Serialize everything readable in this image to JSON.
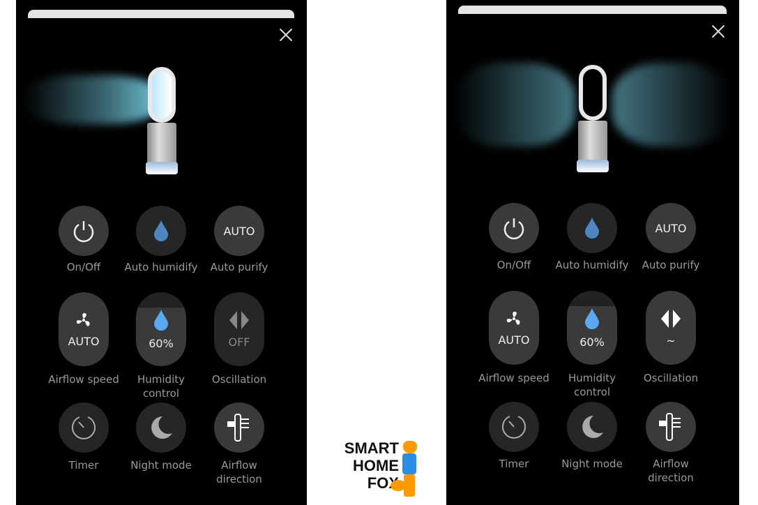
{
  "panels": [
    {
      "buttons": [
        {
          "type": "circle",
          "icon": "power-icon",
          "label": "On/Off"
        },
        {
          "type": "circle",
          "icon": "water-drop-icon",
          "label": "Auto humidify",
          "bg": "#262626",
          "iconColor": "#4f86c0"
        },
        {
          "type": "circle",
          "text": "AUTO",
          "label": "Auto purify"
        },
        {
          "type": "pill",
          "icon": "fan-icon",
          "value": "AUTO",
          "label": "Airflow speed"
        },
        {
          "type": "pill",
          "icon": "water-drop-icon",
          "value": "60%",
          "label": "Humidity control",
          "iconColor": "#5aa8f0",
          "band": true
        },
        {
          "type": "pill",
          "icon": "oscillation-arrows-icon",
          "value": "OFF",
          "label": "Oscillation",
          "bg": "#262626",
          "dim": true
        },
        {
          "type": "circle",
          "icon": "timer-icon",
          "label": "Timer",
          "bg": "#262626"
        },
        {
          "type": "circle",
          "icon": "moon-icon",
          "label": "Night mode",
          "bg": "#262626"
        },
        {
          "type": "circle",
          "icon": "airflow-direction-icon",
          "label": "Airflow direction"
        }
      ]
    },
    {
      "buttons": [
        {
          "type": "circle",
          "icon": "power-icon",
          "label": "On/Off"
        },
        {
          "type": "circle",
          "icon": "water-drop-icon",
          "label": "Auto humidify",
          "bg": "#262626",
          "iconColor": "#4f86c0"
        },
        {
          "type": "circle",
          "text": "AUTO",
          "label": "Auto purify"
        },
        {
          "type": "pill",
          "icon": "fan-icon",
          "value": "AUTO",
          "label": "Airflow speed"
        },
        {
          "type": "pill",
          "icon": "water-drop-icon",
          "value": "60%",
          "label": "Humidity control",
          "iconColor": "#5aa8f0",
          "band": true
        },
        {
          "type": "pill",
          "icon": "oscillation-arrows-icon",
          "value": "~",
          "label": "Oscillation"
        },
        {
          "type": "circle",
          "icon": "timer-icon",
          "label": "Timer",
          "bg": "#262626"
        },
        {
          "type": "circle",
          "icon": "moon-icon",
          "label": "Night mode",
          "bg": "#262626"
        },
        {
          "type": "circle",
          "icon": "airflow-direction-icon",
          "label": "Airflow direction"
        }
      ]
    }
  ],
  "logo": {
    "text": "SMART HOME FOX"
  },
  "colors": {
    "airflow": "#6fc3d8",
    "accent": "#5aa8f0"
  }
}
